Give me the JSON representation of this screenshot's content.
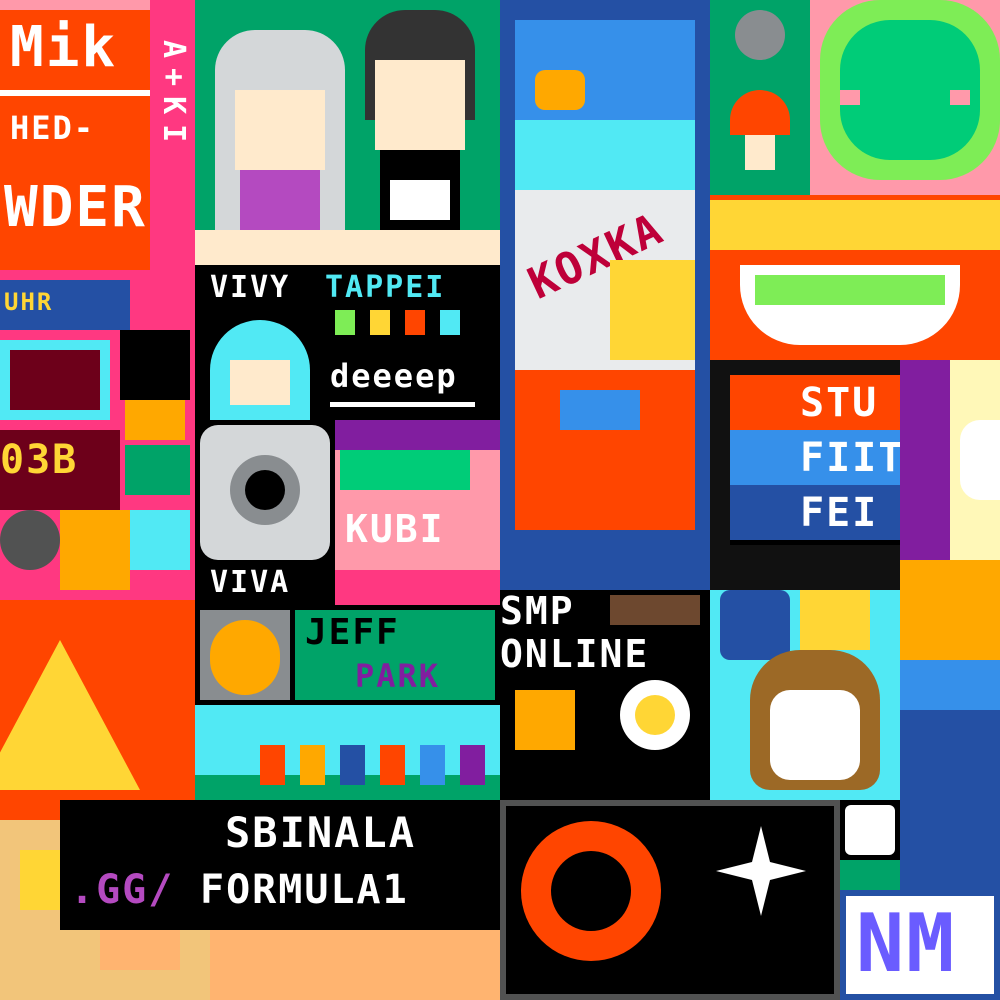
{
  "canvas": {
    "background": "#111111"
  },
  "artworks": {
    "mik": {
      "line1": "Mik",
      "line2": "HED-",
      "line3": "WDER",
      "side": "A+KI"
    },
    "vivy": {
      "label": "VIVY"
    },
    "tappei": {
      "label": "TAPPEI"
    },
    "deeeep": {
      "label": "deeeep"
    },
    "viva": {
      "label": "VIVA"
    },
    "snack": {
      "label": "KOXKA"
    },
    "stu": {
      "rows": [
        "STU",
        "FIIT",
        "FEI"
      ]
    },
    "smp": {
      "line1": "SMP",
      "line2": "ONLINE"
    },
    "jeff": {
      "line1": "JEFF",
      "line2": "PARK"
    },
    "bottom": {
      "line1": "SBINALA",
      "line2": ".GG/",
      "line3": "FORMULA1"
    },
    "nm": {
      "label": "NM"
    },
    "kubi": {
      "label": "KUBI"
    }
  },
  "colors": {
    "orange": "#ff4500",
    "pink": "#ff3881",
    "green": "#00a368",
    "blue": "#2450a4",
    "yellow": "#ffd635",
    "black": "#000000",
    "white": "#ffffff"
  }
}
